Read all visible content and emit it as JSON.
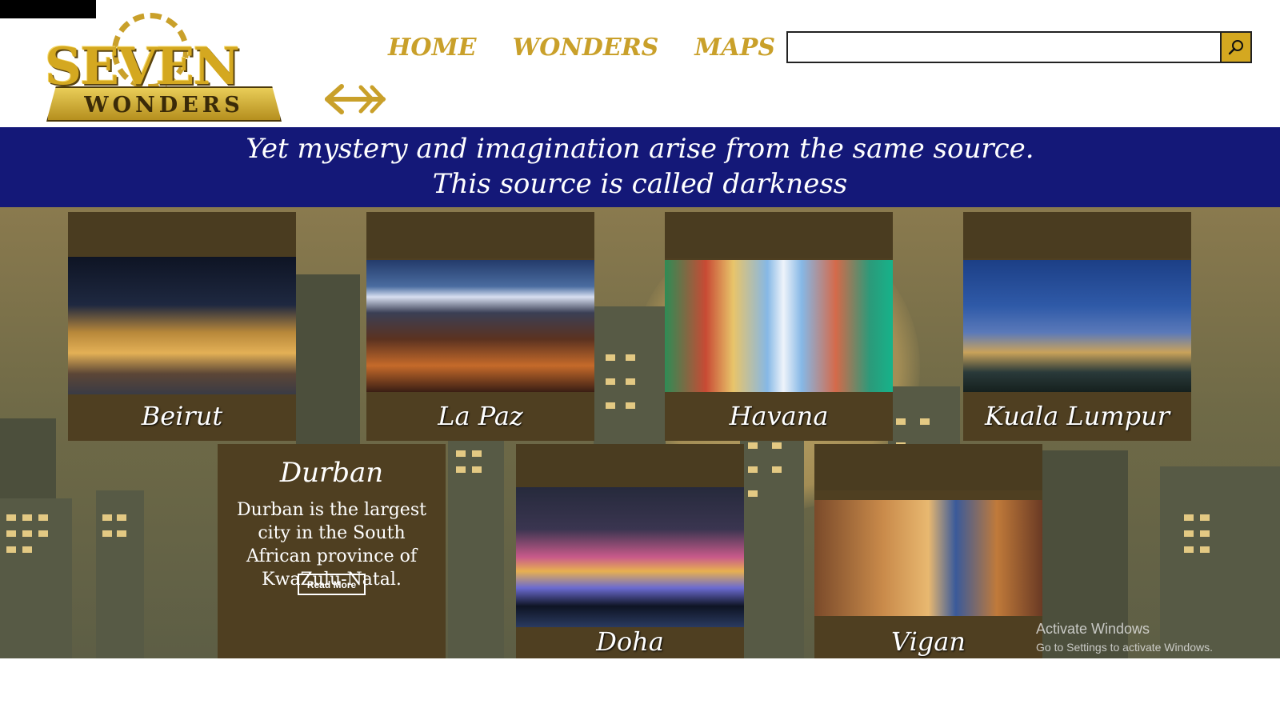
{
  "logo": {
    "main": "SEVEN",
    "sub": "WONDERS"
  },
  "nav": {
    "home": "HOME",
    "wonders": "WONDERS",
    "maps": "MAPS"
  },
  "search": {
    "value": "",
    "placeholder": ""
  },
  "quote": {
    "line1": "Yet mystery and imagination arise from the same source.",
    "line2": "This source is called darkness"
  },
  "cities": [
    {
      "name": "Beirut"
    },
    {
      "name": "La Paz"
    },
    {
      "name": "Havana"
    },
    {
      "name": "Kuala Lumpur"
    },
    {
      "name": "Doha"
    },
    {
      "name": "Vigan"
    }
  ],
  "featured": {
    "title": "Durban",
    "description": "Durban is the largest city in the South African province of KwaZulu-Natal.",
    "read_more": "Read More"
  },
  "watermark": {
    "line1": "Activate Windows",
    "line2": "Go to Settings to activate Windows."
  },
  "colors": {
    "gold": "#c9a02a",
    "banner": "#141878",
    "card": "#4f3f21"
  }
}
